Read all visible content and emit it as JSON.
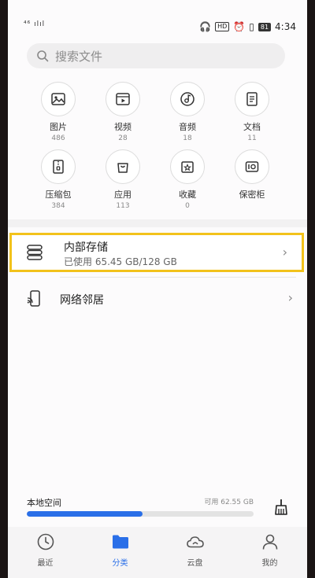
{
  "status": {
    "left": "⁴⁶ ılıl",
    "time": "4:34",
    "badge": "HD",
    "battery": "81"
  },
  "search": {
    "placeholder": "搜索文件"
  },
  "categories": [
    {
      "label": "图片",
      "count": "486"
    },
    {
      "label": "视频",
      "count": "28"
    },
    {
      "label": "音频",
      "count": "18"
    },
    {
      "label": "文档",
      "count": "11"
    },
    {
      "label": "压缩包",
      "count": "384"
    },
    {
      "label": "应用",
      "count": "113"
    },
    {
      "label": "收藏",
      "count": "0"
    },
    {
      "label": "保密柜",
      "count": ""
    }
  ],
  "storage": {
    "title": "内部存储",
    "used": "已使用 65.45 GB/128 GB",
    "used_fraction": 0.511
  },
  "network": {
    "title": "网络邻居"
  },
  "local": {
    "label": "本地空间",
    "free": "可用 62.55 GB"
  },
  "nav": [
    {
      "label": "最近",
      "icon": "clock-icon"
    },
    {
      "label": "分类",
      "icon": "folder-icon"
    },
    {
      "label": "云盘",
      "icon": "cloud-icon"
    },
    {
      "label": "我的",
      "icon": "person-icon"
    }
  ],
  "colors": {
    "accent": "#2a6fe8",
    "highlight": "#f2c21b"
  }
}
